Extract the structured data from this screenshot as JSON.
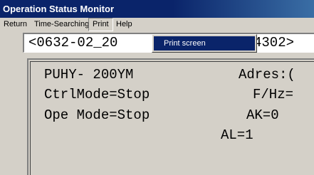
{
  "window": {
    "title": "Operation Status Monitor"
  },
  "menu": {
    "items": [
      "Return",
      "Time-Searching",
      "Print",
      "Help"
    ]
  },
  "address": {
    "text": "<0632-02_20",
    "text_right": "4302>"
  },
  "print_menu": {
    "items": [
      "Print screen"
    ]
  },
  "status": {
    "model": "PUHY- 200YM",
    "address_label": "Adres:(",
    "ctrl_mode": "CtrlMode=Stop",
    "f_hz": "F/Hz=",
    "ope_mode": "Ope Mode=Stop",
    "ak": "AK=0",
    "al": "AL=1"
  },
  "colors": {
    "titlebar": "#0a246a",
    "menu_highlight": "#0a246a",
    "face": "#d4d0c8"
  }
}
